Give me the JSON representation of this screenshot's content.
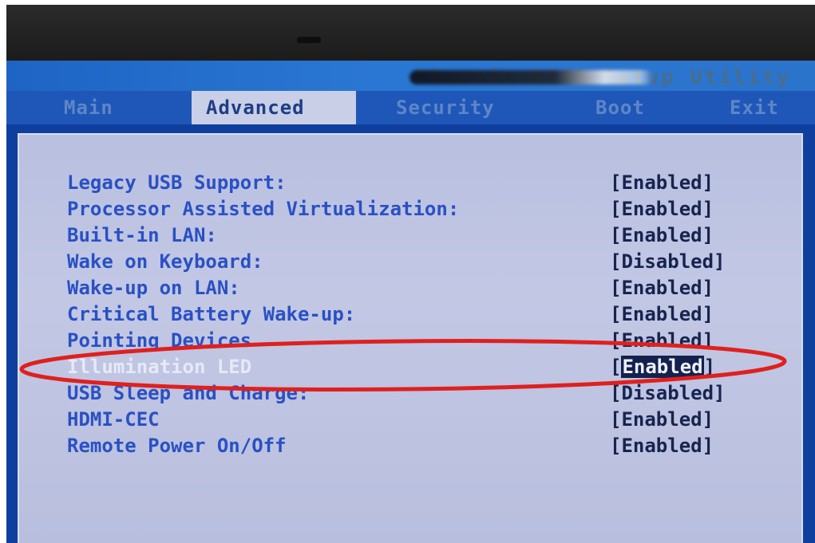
{
  "app_title": "Phoenix BIOS Setup Utility",
  "tabs": [
    {
      "label": "Main",
      "active": false
    },
    {
      "label": "Advanced",
      "active": true
    },
    {
      "label": "Security",
      "active": false
    },
    {
      "label": "Boot",
      "active": false
    },
    {
      "label": "Exit",
      "active": false
    }
  ],
  "settings": [
    {
      "label": "Legacy USB Support:",
      "value": "Enabled"
    },
    {
      "label": "Processor Assisted Virtualization:",
      "value": "Enabled"
    },
    {
      "label": "Built-in LAN:",
      "value": "Enabled"
    },
    {
      "label": "Wake on Keyboard:",
      "value": "Disabled"
    },
    {
      "label": "Wake-up on LAN:",
      "value": "Enabled"
    },
    {
      "label": "Critical Battery Wake-up:",
      "value": "Enabled"
    },
    {
      "label": "Pointing Devices",
      "value": "Enabled"
    },
    {
      "label": "Illumination LED",
      "value": "Enabled",
      "selected": true
    },
    {
      "label": "USB Sleep and Charge:",
      "value": "Disabled"
    },
    {
      "label": "HDMI-CEC",
      "value": "Enabled"
    },
    {
      "label": "Remote Power On/Off",
      "value": "Enabled"
    }
  ],
  "colors": {
    "screen_bg": "#0f3f9e",
    "menubar_bg": "#1f57b8",
    "content_bg": "#c2c8e4",
    "label_color": "#2a50c4",
    "value_color": "#17244f",
    "highlight_bg": "#14214e",
    "annotation_red": "#e0201e"
  },
  "annotation": {
    "shape": "ellipse",
    "color": "#e0201e",
    "target": "Illumination LED"
  }
}
